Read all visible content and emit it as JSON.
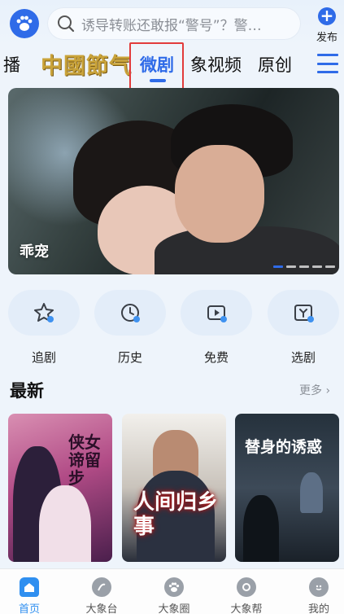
{
  "header": {
    "search_placeholder": "诱导转账还敢报“警号”？警…",
    "publish_label": "发布"
  },
  "tabs": [
    {
      "label": "播"
    },
    {
      "label": "中國節气"
    },
    {
      "label": "微剧",
      "active": true
    },
    {
      "label": "象视频"
    },
    {
      "label": "原创"
    }
  ],
  "banner": {
    "title": "乖宠",
    "pages": 5,
    "current_page": 1
  },
  "quick_entries": [
    {
      "label": "追剧",
      "icon": "star-icon"
    },
    {
      "label": "历史",
      "icon": "clock-icon"
    },
    {
      "label": "免费",
      "icon": "play-icon"
    },
    {
      "label": "选剧",
      "icon": "select-icon"
    }
  ],
  "section": {
    "title": "最新",
    "more_label": "更多 ›"
  },
  "posters": [
    {
      "title": "侠女谛留步"
    },
    {
      "title": "人间归乡事"
    },
    {
      "title": "替身的诱惑"
    }
  ],
  "bottom_nav": [
    {
      "label": "首页",
      "icon": "home-icon",
      "active": true
    },
    {
      "label": "大象台",
      "icon": "tv-icon"
    },
    {
      "label": "大象圈",
      "icon": "paw-icon"
    },
    {
      "label": "大象帮",
      "icon": "help-icon"
    },
    {
      "label": "我的",
      "icon": "profile-icon"
    }
  ],
  "colors": {
    "accent": "#2f6be8",
    "highlight_box": "#e23b3b",
    "background": "#eef4fb"
  }
}
